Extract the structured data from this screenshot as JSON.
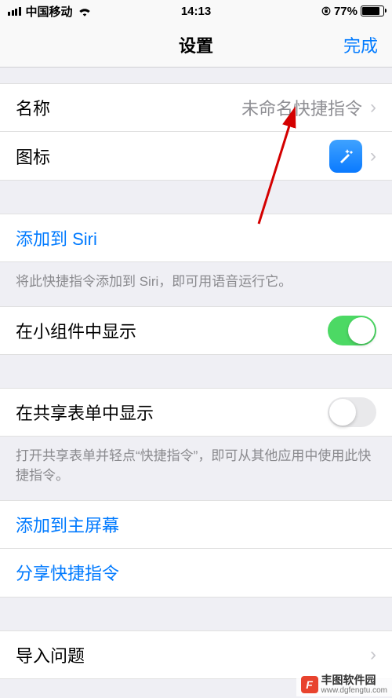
{
  "status": {
    "carrier": "中国移动",
    "time": "14:13",
    "battery_pct": "77%"
  },
  "nav": {
    "title": "设置",
    "done": "完成"
  },
  "cells": {
    "name_label": "名称",
    "name_value": "未命名快捷指令",
    "icon_label": "图标",
    "add_siri": "添加到 Siri",
    "add_siri_note": "将此快捷指令添加到 Siri，即可用语音运行它。",
    "widget_label": "在小组件中显示",
    "share_sheet_label": "在共享表单中显示",
    "share_sheet_note": "打开共享表单并轻点“快捷指令”，即可从其他应用中使用此快捷指令。",
    "add_home": "添加到主屏幕",
    "share_shortcut": "分享快捷指令",
    "import_q": "导入问题"
  },
  "toggles": {
    "widget_on": true,
    "share_sheet_on": false
  },
  "watermark": {
    "letter": "F",
    "title": "丰图软件园",
    "url": "www.dgfengtu.com"
  }
}
